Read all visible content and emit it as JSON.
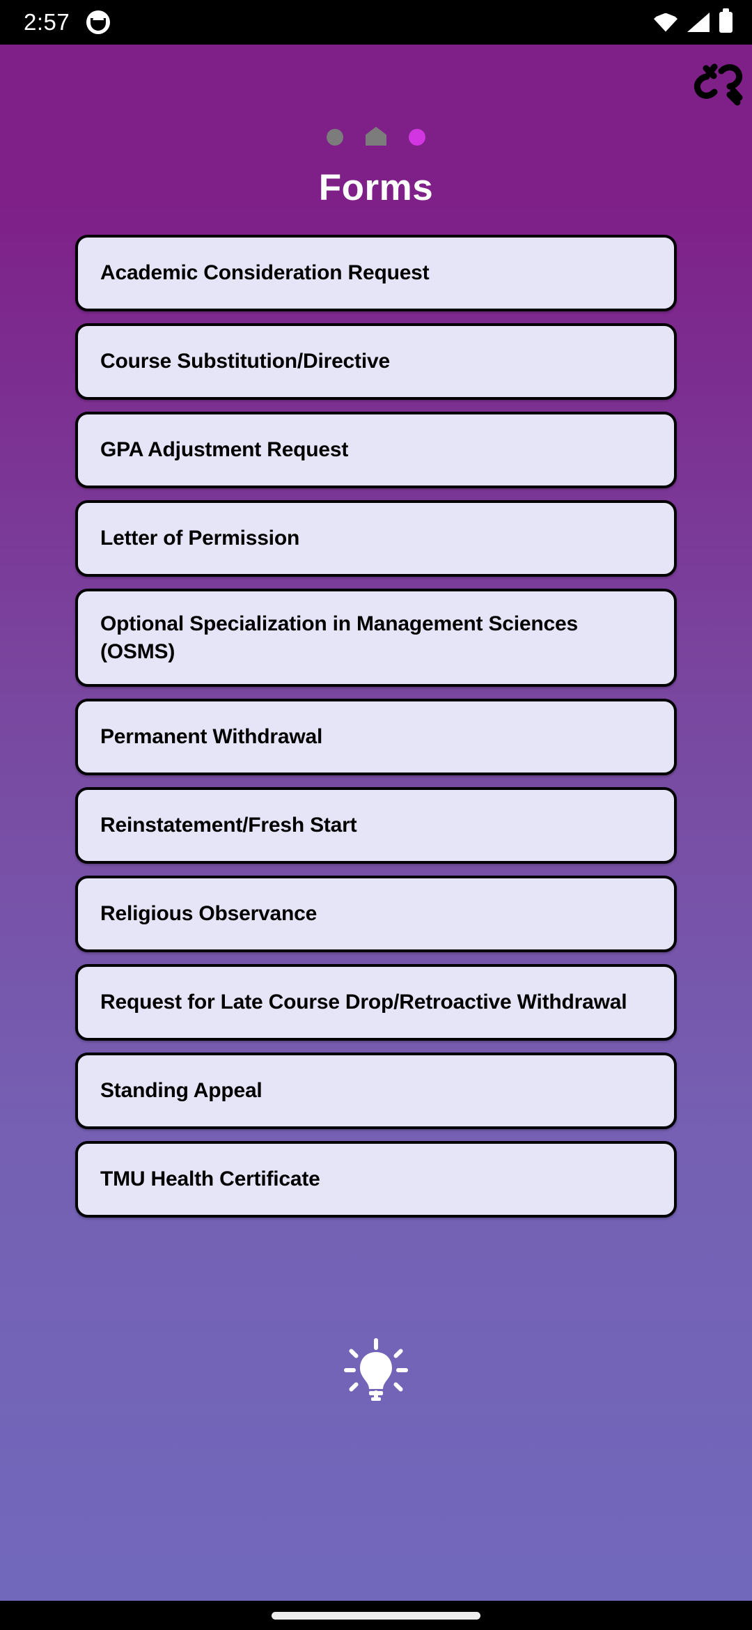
{
  "statusbar": {
    "time": "2:57",
    "app_icon": "cat-face-icon",
    "wifi_icon": "wifi-icon",
    "signal_icon": "cellular-signal-icon",
    "battery_icon": "battery-full-icon"
  },
  "header": {
    "title": "Forms",
    "unlink_icon": "broken-link-icon",
    "step_indicators": [
      {
        "name": "step-dot-circle",
        "type": "circle",
        "color": "#7C7C7C",
        "state": "inactive"
      },
      {
        "name": "step-dot-home",
        "type": "home",
        "color": "#7C7C7C",
        "state": "inactive"
      },
      {
        "name": "step-dot-current",
        "type": "circle",
        "color": "#D236E0",
        "state": "active"
      }
    ]
  },
  "forms": [
    {
      "label": "Academic Consideration Request"
    },
    {
      "label": "Course Substitution/Directive"
    },
    {
      "label": "GPA Adjustment Request"
    },
    {
      "label": "Letter of Permission"
    },
    {
      "label": "Optional Specialization in Management Sciences (OSMS)"
    },
    {
      "label": "Permanent Withdrawal"
    },
    {
      "label": "Reinstatement/Fresh Start"
    },
    {
      "label": "Religious Observance"
    },
    {
      "label": "Request for Late Course Drop/Retroactive Withdrawal"
    },
    {
      "label": "Standing Appeal"
    },
    {
      "label": "TMU Health Certificate"
    }
  ],
  "footer": {
    "hint_icon": "lightbulb-icon"
  },
  "navbar": {
    "gesture_pill": "home-gesture-pill"
  },
  "colors": {
    "gradient_top": "#7E2088",
    "gradient_bottom": "#7168BC",
    "card_fill": "#E6E4F7",
    "card_border": "#000000",
    "accent": "#D236E0",
    "title_text": "#FFFFFF"
  }
}
